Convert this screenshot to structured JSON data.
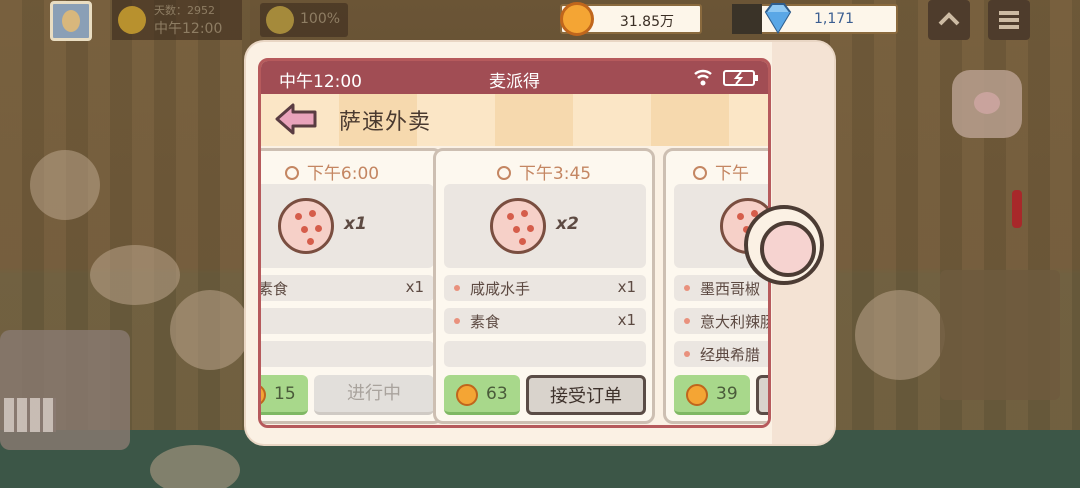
{
  "hud": {
    "days_label": "天数：2952",
    "time": "中午12:00",
    "mood": "100%",
    "coins": "31.85万",
    "gems": "1,171"
  },
  "phone": {
    "status_time": "中午12:00",
    "carrier": "麦派得",
    "app_title": "萨速外卖",
    "orders": [
      {
        "time": "下午6:00",
        "qty": "x1",
        "items": [
          {
            "name": "素食",
            "count": "x1"
          }
        ],
        "reward": "15",
        "action": "进行中"
      },
      {
        "time": "下午3:45",
        "qty": "x2",
        "items": [
          {
            "name": "咸咸水手",
            "count": "x1"
          },
          {
            "name": "素食",
            "count": "x1"
          }
        ],
        "reward": "63",
        "action": "接受订单"
      },
      {
        "time": "下午",
        "qty": "",
        "items": [
          {
            "name": "墨西哥椒",
            "count": ""
          },
          {
            "name": "意大利辣肠",
            "count": ""
          },
          {
            "name": "经典希腊",
            "count": ""
          }
        ],
        "reward": "39",
        "action": ""
      }
    ]
  },
  "colors": {
    "status_bar": "#a14d54",
    "accent_coin": "#f4a534",
    "reward_green": "#a8d88b"
  }
}
